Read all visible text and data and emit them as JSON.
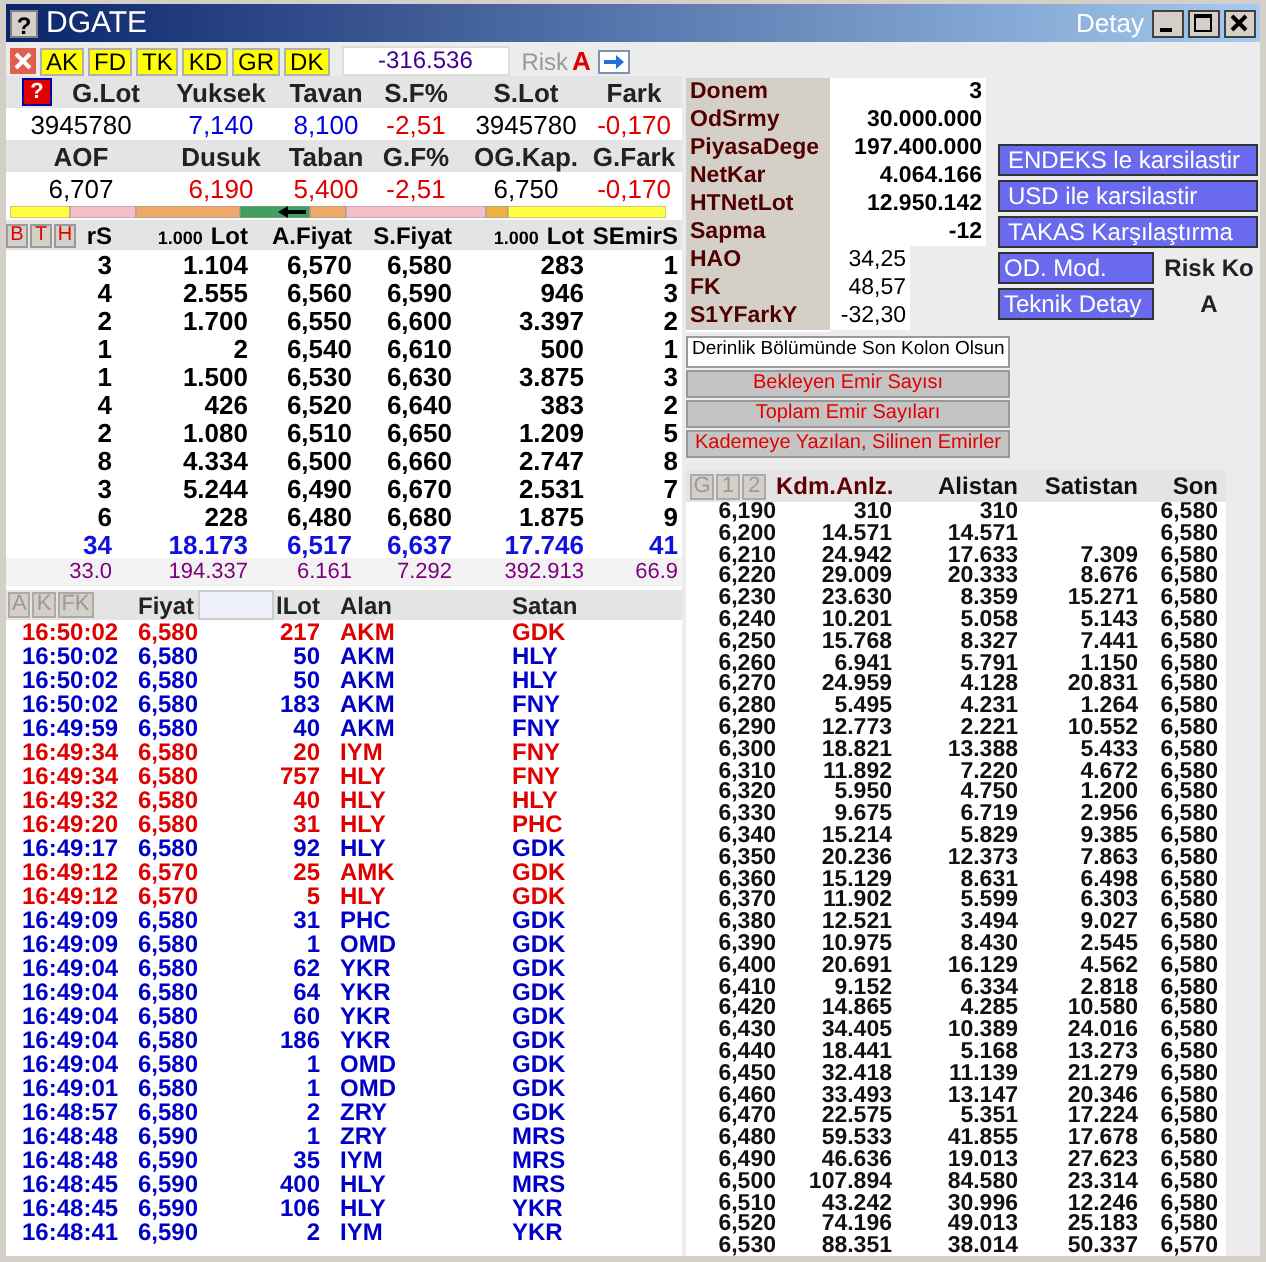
{
  "window": {
    "icon_glyph": "?",
    "title": "DGATE",
    "caption": "Detay"
  },
  "toolbar": {
    "tags": [
      "AK",
      "FD",
      "TK",
      "KD",
      "GR",
      "DK"
    ],
    "value": "-316.536",
    "risk_label": "Risk",
    "risk_grade": "A"
  },
  "summary": {
    "help": "?",
    "blocks": [
      {
        "headers": [
          "G.Lot",
          "Yuksek",
          "Tavan",
          "S.F%",
          "S.Lot",
          "Fark"
        ],
        "values": [
          {
            "text": "3945780",
            "color": "#000000"
          },
          {
            "text": "7,140",
            "color": "#0000e0"
          },
          {
            "text": "8,100",
            "color": "#0000e0"
          },
          {
            "text": "-2,51",
            "color": "#e00000"
          },
          {
            "text": "3945780",
            "color": "#000000"
          },
          {
            "text": "-0,170",
            "color": "#e00000"
          }
        ]
      },
      {
        "headers": [
          "AOF",
          "Dusuk",
          "Taban",
          "G.F%",
          "OG.Kap.",
          "G.Fark"
        ],
        "values": [
          {
            "text": "6,707",
            "color": "#000000"
          },
          {
            "text": "6,190",
            "color": "#e00000"
          },
          {
            "text": "5,400",
            "color": "#e00000"
          },
          {
            "text": "-2,51",
            "color": "#e00000"
          },
          {
            "text": "6,750",
            "color": "#000000"
          },
          {
            "text": "-0,170",
            "color": "#e00000"
          }
        ]
      }
    ]
  },
  "depth": {
    "tabs": [
      "B",
      "T",
      "H"
    ],
    "columns": [
      {
        "label": "rS"
      },
      {
        "unit": "1.000",
        "label": "Lot"
      },
      {
        "label": "A.Fiyat"
      },
      {
        "label": "S.Fiyat"
      },
      {
        "unit": "1.000",
        "label": "Lot"
      },
      {
        "label": "SEmirS"
      }
    ],
    "rows": [
      [
        "3",
        "1.104",
        "6,570",
        "6,580",
        "283",
        "1"
      ],
      [
        "4",
        "2.555",
        "6,560",
        "6,590",
        "946",
        "3"
      ],
      [
        "2",
        "1.700",
        "6,550",
        "6,600",
        "3.397",
        "2"
      ],
      [
        "1",
        "2",
        "6,540",
        "6,610",
        "500",
        "1"
      ],
      [
        "1",
        "1.500",
        "6,530",
        "6,630",
        "3.875",
        "3"
      ],
      [
        "4",
        "426",
        "6,520",
        "6,640",
        "383",
        "2"
      ],
      [
        "2",
        "1.080",
        "6,510",
        "6,650",
        "1.209",
        "5"
      ],
      [
        "8",
        "4.334",
        "6,500",
        "6,660",
        "2.747",
        "8"
      ],
      [
        "3",
        "5.244",
        "6,490",
        "6,670",
        "2.531",
        "7"
      ],
      [
        "6",
        "228",
        "6,480",
        "6,680",
        "1.875",
        "9"
      ]
    ],
    "totals": [
      "34",
      "18.173",
      "6,517",
      "6,637",
      "17.746",
      "41"
    ],
    "averages": [
      "33.0",
      "194.337",
      "6.161",
      "7.292",
      "392.913",
      "66.9"
    ]
  },
  "trades": {
    "tabs": [
      "A",
      "K",
      "FK"
    ],
    "columns": [
      "",
      "Fiyat",
      "lLot",
      "Alan",
      "Satan"
    ],
    "rows": [
      {
        "color": "#e00000",
        "cells": [
          "16:50:02",
          "6,580",
          "217",
          "AKM",
          "GDK"
        ]
      },
      {
        "color": "#0000c8",
        "cells": [
          "16:50:02",
          "6,580",
          "50",
          "AKM",
          "HLY"
        ]
      },
      {
        "color": "#0000c8",
        "cells": [
          "16:50:02",
          "6,580",
          "50",
          "AKM",
          "HLY"
        ]
      },
      {
        "color": "#0000c8",
        "cells": [
          "16:50:02",
          "6,580",
          "183",
          "AKM",
          "FNY"
        ]
      },
      {
        "color": "#0000c8",
        "cells": [
          "16:49:59",
          "6,580",
          "40",
          "AKM",
          "FNY"
        ]
      },
      {
        "color": "#e00000",
        "cells": [
          "16:49:34",
          "6,580",
          "20",
          "IYM",
          "FNY"
        ]
      },
      {
        "color": "#e00000",
        "cells": [
          "16:49:34",
          "6,580",
          "757",
          "HLY",
          "FNY"
        ]
      },
      {
        "color": "#e00000",
        "cells": [
          "16:49:32",
          "6,580",
          "40",
          "HLY",
          "HLY"
        ]
      },
      {
        "color": "#e00000",
        "cells": [
          "16:49:20",
          "6,580",
          "31",
          "HLY",
          "PHC"
        ]
      },
      {
        "color": "#0000c8",
        "cells": [
          "16:49:17",
          "6,580",
          "92",
          "HLY",
          "GDK"
        ]
      },
      {
        "color": "#e00000",
        "cells": [
          "16:49:12",
          "6,570",
          "25",
          "AMK",
          "GDK"
        ]
      },
      {
        "color": "#e00000",
        "cells": [
          "16:49:12",
          "6,570",
          "5",
          "HLY",
          "GDK"
        ]
      },
      {
        "color": "#0000c8",
        "cells": [
          "16:49:09",
          "6,580",
          "31",
          "PHC",
          "GDK"
        ]
      },
      {
        "color": "#0000c8",
        "cells": [
          "16:49:09",
          "6,580",
          "1",
          "OMD",
          "GDK"
        ]
      },
      {
        "color": "#0000c8",
        "cells": [
          "16:49:04",
          "6,580",
          "62",
          "YKR",
          "GDK"
        ]
      },
      {
        "color": "#0000c8",
        "cells": [
          "16:49:04",
          "6,580",
          "64",
          "YKR",
          "GDK"
        ]
      },
      {
        "color": "#0000c8",
        "cells": [
          "16:49:04",
          "6,580",
          "60",
          "YKR",
          "GDK"
        ]
      },
      {
        "color": "#0000c8",
        "cells": [
          "16:49:04",
          "6,580",
          "186",
          "YKR",
          "GDK"
        ]
      },
      {
        "color": "#0000c8",
        "cells": [
          "16:49:04",
          "6,580",
          "1",
          "OMD",
          "GDK"
        ]
      },
      {
        "color": "#0000c8",
        "cells": [
          "16:49:01",
          "6,580",
          "1",
          "OMD",
          "GDK"
        ]
      },
      {
        "color": "#0000c8",
        "cells": [
          "16:48:57",
          "6,580",
          "2",
          "ZRY",
          "GDK"
        ]
      },
      {
        "color": "#0000c8",
        "cells": [
          "16:48:48",
          "6,590",
          "1",
          "ZRY",
          "MRS"
        ]
      },
      {
        "color": "#0000c8",
        "cells": [
          "16:48:48",
          "6,590",
          "35",
          "IYM",
          "MRS"
        ]
      },
      {
        "color": "#0000c8",
        "cells": [
          "16:48:45",
          "6,590",
          "400",
          "HLY",
          "MRS"
        ]
      },
      {
        "color": "#0000c8",
        "cells": [
          "16:48:45",
          "6,590",
          "106",
          "HLY",
          "YKR"
        ]
      },
      {
        "color": "#0000c8",
        "cells": [
          "16:48:41",
          "6,590",
          "2",
          "IYM",
          "YKR"
        ]
      }
    ]
  },
  "info": {
    "fundamentals": [
      {
        "label": "Donem",
        "value": "3"
      },
      {
        "label": "OdSrmy",
        "value": "30.000.000"
      },
      {
        "label": "PiyasaDege",
        "value": "197.400.000"
      },
      {
        "label": "NetKar",
        "value": "4.064.166"
      },
      {
        "label": "HTNetLot",
        "value": "12.950.142"
      },
      {
        "label": "Sapma",
        "value": "-12"
      }
    ],
    "ratios": [
      {
        "label": "HAO",
        "value": "34,25"
      },
      {
        "label": "FK",
        "value": "48,57"
      },
      {
        "label": "S1YFarkY",
        "value": "-32,30"
      }
    ]
  },
  "actions": {
    "compare": [
      "ENDEKS le karsilastir",
      "USD ile karsilastir",
      "TAKAS Karşılaştırma"
    ],
    "modes": [
      {
        "label": "OD. Mod.",
        "value": "Risk Ko"
      },
      {
        "label": "Teknik Detay",
        "value": "A"
      }
    ]
  },
  "options": {
    "toggle": "Derinlik Bölümünde Son Kolon Olsun",
    "buttons": [
      "Bekleyen Emir Sayısı",
      "Toplam Emir Sayıları",
      "Kademeye Yazılan, Silinen Emirler"
    ]
  },
  "levels": {
    "tabs": [
      "G",
      "1",
      "2"
    ],
    "columns": [
      "Kdm.Anlz.",
      "Alistan",
      "Satistan",
      "Son"
    ],
    "rows": [
      {
        "price": "6,190",
        "total": "310",
        "buy": "310",
        "last": "6,580"
      },
      {
        "price": "6,200",
        "total": "14.571",
        "buy": "14.571",
        "last": "6,580"
      },
      {
        "price": "6,210",
        "total": "24.942",
        "buy": "17.633",
        "sell": "7.309",
        "last": "6,580"
      },
      {
        "price": "6,220",
        "total": "29.009",
        "buy": "20.333",
        "sell": "8.676",
        "last": "6,580"
      },
      {
        "price": "6,230",
        "total": "23.630",
        "buy": "8.359",
        "sell": "15.271",
        "last": "6,580"
      },
      {
        "price": "6,240",
        "total": "10.201",
        "buy": "5.058",
        "sell": "5.143",
        "last": "6,580"
      },
      {
        "price": "6,250",
        "total": "15.768",
        "buy": "8.327",
        "sell": "7.441",
        "last": "6,580"
      },
      {
        "price": "6,260",
        "total": "6.941",
        "buy": "5.791",
        "sell": "1.150",
        "last": "6,580"
      },
      {
        "price": "6,270",
        "total": "24.959",
        "buy": "4.128",
        "sell": "20.831",
        "last": "6,580"
      },
      {
        "price": "6,280",
        "total": "5.495",
        "buy": "4.231",
        "sell": "1.264",
        "last": "6,580"
      },
      {
        "price": "6,290",
        "total": "12.773",
        "buy": "2.221",
        "sell": "10.552",
        "last": "6,580"
      },
      {
        "price": "6,300",
        "total": "18.821",
        "buy": "13.388",
        "sell": "5.433",
        "last": "6,580"
      },
      {
        "price": "6,310",
        "total": "11.892",
        "buy": "7.220",
        "sell": "4.672",
        "last": "6,580"
      },
      {
        "price": "6,320",
        "total": "5.950",
        "buy": "4.750",
        "sell": "1.200",
        "last": "6,580"
      },
      {
        "price": "6,330",
        "total": "9.675",
        "buy": "6.719",
        "sell": "2.956",
        "last": "6,580"
      },
      {
        "price": "6,340",
        "total": "15.214",
        "buy": "5.829",
        "sell": "9.385",
        "last": "6,580"
      },
      {
        "price": "6,350",
        "total": "20.236",
        "buy": "12.373",
        "sell": "7.863",
        "last": "6,580"
      },
      {
        "price": "6,360",
        "total": "15.129",
        "buy": "8.631",
        "sell": "6.498",
        "last": "6,580"
      },
      {
        "price": "6,370",
        "total": "11.902",
        "buy": "5.599",
        "sell": "6.303",
        "last": "6,580"
      },
      {
        "price": "6,380",
        "total": "12.521",
        "buy": "3.494",
        "sell": "9.027",
        "last": "6,580"
      },
      {
        "price": "6,390",
        "total": "10.975",
        "buy": "8.430",
        "sell": "2.545",
        "last": "6,580"
      },
      {
        "price": "6,400",
        "total": "20.691",
        "buy": "16.129",
        "sell": "4.562",
        "last": "6,580"
      },
      {
        "price": "6,410",
        "total": "9.152",
        "buy": "6.334",
        "sell": "2.818",
        "last": "6,580"
      },
      {
        "price": "6,420",
        "total": "14.865",
        "buy": "4.285",
        "sell": "10.580",
        "last": "6,580"
      },
      {
        "price": "6,430",
        "total": "34.405",
        "buy": "10.389",
        "sell": "24.016",
        "last": "6,580"
      },
      {
        "price": "6,440",
        "total": "18.441",
        "buy": "5.168",
        "sell": "13.273",
        "last": "6,580"
      },
      {
        "price": "6,450",
        "total": "32.418",
        "buy": "11.139",
        "sell": "21.279",
        "last": "6,580"
      },
      {
        "price": "6,460",
        "total": "33.493",
        "buy": "13.147",
        "sell": "20.346",
        "last": "6,580"
      },
      {
        "price": "6,470",
        "total": "22.575",
        "buy": "5.351",
        "sell": "17.224",
        "last": "6,580"
      },
      {
        "price": "6,480",
        "total": "59.533",
        "buy": "41.855",
        "sell": "17.678",
        "last": "6,580"
      },
      {
        "price": "6,490",
        "total": "46.636",
        "buy": "19.013",
        "sell": "27.623",
        "last": "6,580"
      },
      {
        "price": "6,500",
        "total": "107.894",
        "buy": "84.580",
        "sell": "23.314",
        "last": "6,580"
      },
      {
        "price": "6,510",
        "total": "43.242",
        "buy": "30.996",
        "sell": "12.246",
        "last": "6,580"
      },
      {
        "price": "6,520",
        "total": "74.196",
        "buy": "49.013",
        "sell": "25.183",
        "last": "6,580"
      },
      {
        "price": "6,530",
        "total": "88.351",
        "buy": "38.014",
        "sell": "50.337",
        "last": "6,570"
      }
    ]
  }
}
